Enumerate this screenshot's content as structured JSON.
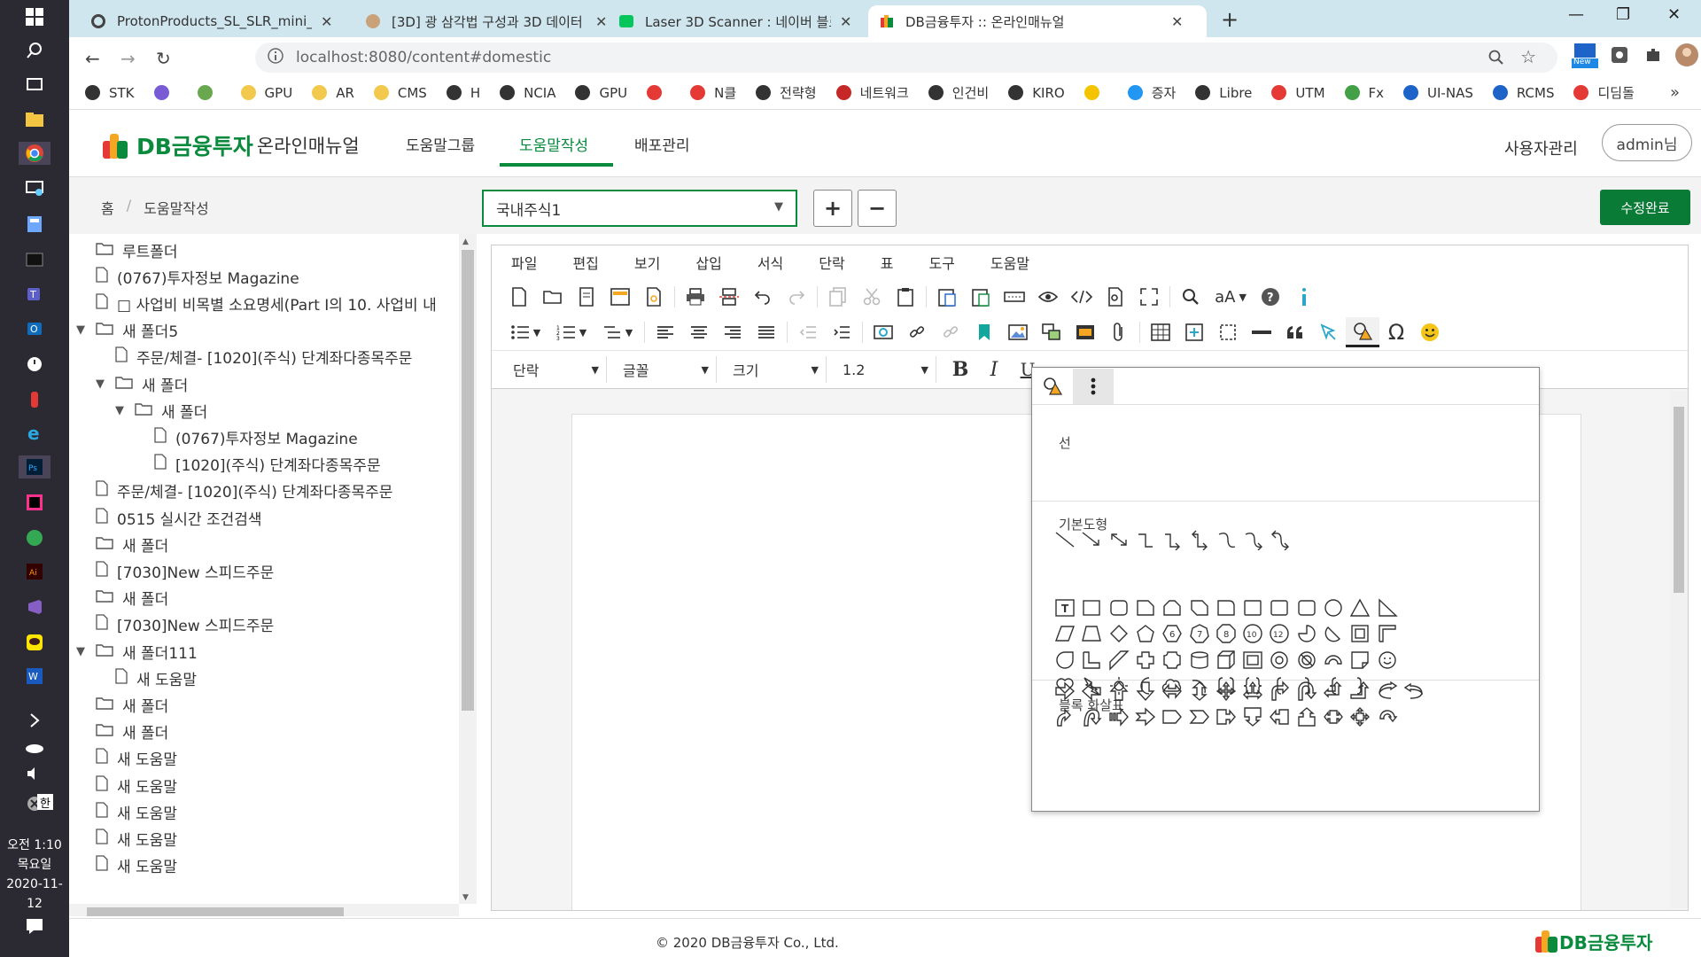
{
  "taskbar": {
    "time": "오전 1:10",
    "day": "목요일",
    "date": "2020-11-12",
    "lang": "한"
  },
  "browser": {
    "tabs": [
      {
        "title": "ProtonProducts_SL_SLR_mini_cat"
      },
      {
        "title": "[3D] 광 삼각법 구성과 3D 데이터"
      },
      {
        "title": "Laser 3D Scanner : 네이버 블로그"
      },
      {
        "title": "DB금융투자 :: 온라인매뉴얼",
        "active": true
      }
    ],
    "url": "localhost:8080/content#domestic",
    "new_badge": "New",
    "bookmarks": [
      {
        "label": "STK",
        "color": "#333333"
      },
      {
        "label": "",
        "color": "#7a5bd6"
      },
      {
        "label": "",
        "color": "#6aa84f"
      },
      {
        "label": "GPU",
        "color": "#f2c94c"
      },
      {
        "label": "AR",
        "color": "#f2c94c"
      },
      {
        "label": "CMS",
        "color": "#f2c94c"
      },
      {
        "label": "H",
        "color": "#333333"
      },
      {
        "label": "NCIA",
        "color": "#333333"
      },
      {
        "label": "GPU",
        "color": "#333333"
      },
      {
        "label": "",
        "color": "#e53935"
      },
      {
        "label": "N클",
        "color": "#e53935"
      },
      {
        "label": "전략형",
        "color": "#333333"
      },
      {
        "label": "네트워크",
        "color": "#c62828"
      },
      {
        "label": "인건비",
        "color": "#333333"
      },
      {
        "label": "KIRO",
        "color": "#333333"
      },
      {
        "label": "",
        "color": "#f5c400"
      },
      {
        "label": "증자",
        "color": "#2196f3"
      },
      {
        "label": "Libre",
        "color": "#333333"
      },
      {
        "label": "UTM",
        "color": "#e53935"
      },
      {
        "label": "Fx",
        "color": "#43a047"
      },
      {
        "label": "UI-NAS",
        "color": "#1e63c7"
      },
      {
        "label": "RCMS",
        "color": "#1e63c7"
      },
      {
        "label": "디딤돌",
        "color": "#e53935"
      }
    ],
    "more": "»"
  },
  "header": {
    "brand": "DB금융투자",
    "subtitle": "온라인매뉴얼",
    "menu": [
      "도움말그룹",
      "도움말작성",
      "배포관리"
    ],
    "active_menu": "도움말작성",
    "user_mgmt": "사용자관리",
    "admin": "admin님"
  },
  "breadcrumb": {
    "home": "홈",
    "sep": "/",
    "current": "도움말작성"
  },
  "group_select": {
    "value": "국내주식1"
  },
  "buttons": {
    "add": "+",
    "remove": "−",
    "done": "수정완료"
  },
  "tree": [
    {
      "label": "루트폴더",
      "type": "folder",
      "level": 0
    },
    {
      "label": "(0767)투자정보 Magazine",
      "type": "file",
      "level": 0
    },
    {
      "label": "□ 사업비 비목별 소요명세(Part I의 10. 사업비 내",
      "type": "file",
      "level": 0
    },
    {
      "label": "새 폴더5",
      "type": "folder",
      "level": 0,
      "open": true
    },
    {
      "label": "주문/체결- [1020](주식) 단계좌다종목주문",
      "type": "file",
      "level": 1
    },
    {
      "label": "새 폴더",
      "type": "folder",
      "level": 1,
      "open": true
    },
    {
      "label": "새 폴더",
      "type": "folder",
      "level": 2,
      "open": true
    },
    {
      "label": "(0767)투자정보 Magazine",
      "type": "file",
      "level": 3
    },
    {
      "label": "[1020](주식) 단계좌다종목주문",
      "type": "file",
      "level": 3
    },
    {
      "label": "주문/체결- [1020](주식) 단계좌다종목주문",
      "type": "file",
      "level": 0
    },
    {
      "label": "0515 실시간 조건검색",
      "type": "file",
      "level": 0
    },
    {
      "label": "새 폴더",
      "type": "folder",
      "level": 0
    },
    {
      "label": "[7030]New 스피드주문",
      "type": "file",
      "level": 0
    },
    {
      "label": "새 폴더",
      "type": "folder",
      "level": 0
    },
    {
      "label": "[7030]New 스피드주문",
      "type": "file",
      "level": 0
    },
    {
      "label": "새 폴더111",
      "type": "folder",
      "level": 0,
      "open": true
    },
    {
      "label": "새 도움말",
      "type": "file",
      "level": 1
    },
    {
      "label": "새 폴더",
      "type": "folder",
      "level": 0
    },
    {
      "label": "새 폴더",
      "type": "folder",
      "level": 0
    },
    {
      "label": "새 도움말",
      "type": "file",
      "level": 0
    },
    {
      "label": "새 도움말",
      "type": "file",
      "level": 0
    },
    {
      "label": "새 도움말",
      "type": "file",
      "level": 0
    },
    {
      "label": "새 도움말",
      "type": "file",
      "level": 0
    },
    {
      "label": "새 도움말",
      "type": "file",
      "level": 0
    }
  ],
  "editor": {
    "menu": [
      "파일",
      "편집",
      "보기",
      "삽입",
      "서식",
      "단락",
      "표",
      "도구",
      "도움말"
    ],
    "paragraph": "단락",
    "font": "글꼴",
    "size": "크기",
    "line_height": "1.2",
    "case_btn": "aA",
    "bold": "B",
    "italic": "I",
    "underline": "U"
  },
  "shape_popup": {
    "sections": [
      {
        "title": "선",
        "count": 9
      },
      {
        "title": "기본도형",
        "count": 48
      },
      {
        "title": "블록 화살표",
        "count": 28
      }
    ]
  },
  "footer": {
    "copyright": "© 2020 DB금융투자 Co., Ltd.",
    "brand": "DB금융투자"
  },
  "colors": {
    "accent": "#0a8a3c",
    "accent_dark": "#0a7a37",
    "taskbar": "#2b2a33",
    "tabbar": "#cfe6ee"
  }
}
